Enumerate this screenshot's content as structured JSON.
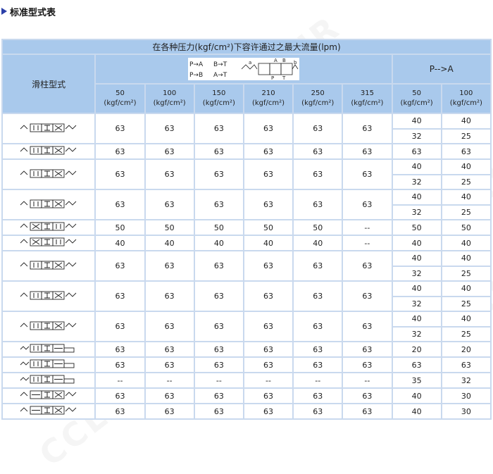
{
  "heading": {
    "text": "标准型式表"
  },
  "table": {
    "top_header": "在各种压力(kgf/cm²)下容许通过之最大流量(lpm)",
    "spool_header": "滑柱型式",
    "pa_header": "P-->A",
    "legend": {
      "line1a": "P→A",
      "line1b": "B→T",
      "line2a": "P→B",
      "line2b": "A→T",
      "port_a": "A",
      "port_b": "B",
      "port_p": "P",
      "port_t": "T",
      "port_sa": "a",
      "port_sb": "b"
    },
    "pressures": [
      "50",
      "100",
      "150",
      "210",
      "250",
      "315"
    ],
    "pa_pressures": [
      "50",
      "100"
    ],
    "unit": "(kgf/cm²)",
    "rows": [
      {
        "vals": [
          "63",
          "63",
          "63",
          "63",
          "63",
          "63"
        ],
        "pa": [
          [
            "40",
            "40"
          ],
          [
            "32",
            "25"
          ]
        ]
      },
      {
        "vals": [
          "63",
          "63",
          "63",
          "63",
          "63",
          "63"
        ],
        "pa": [
          [
            "63",
            "63"
          ]
        ]
      },
      {
        "vals": [
          "63",
          "63",
          "63",
          "63",
          "63",
          "63"
        ],
        "pa": [
          [
            "40",
            "40"
          ],
          [
            "32",
            "25"
          ]
        ]
      },
      {
        "vals": [
          "63",
          "63",
          "63",
          "63",
          "63",
          "63"
        ],
        "pa": [
          [
            "40",
            "40"
          ],
          [
            "32",
            "25"
          ]
        ]
      },
      {
        "vals": [
          "50",
          "50",
          "50",
          "50",
          "50",
          "--"
        ],
        "pa": [
          [
            "50",
            "50"
          ]
        ]
      },
      {
        "vals": [
          "40",
          "40",
          "40",
          "40",
          "40",
          "--"
        ],
        "pa": [
          [
            "40",
            "40"
          ]
        ]
      },
      {
        "vals": [
          "63",
          "63",
          "63",
          "63",
          "63",
          "63"
        ],
        "pa": [
          [
            "40",
            "40"
          ],
          [
            "32",
            "25"
          ]
        ]
      },
      {
        "vals": [
          "63",
          "63",
          "63",
          "63",
          "63",
          "63"
        ],
        "pa": [
          [
            "40",
            "40"
          ],
          [
            "32",
            "25"
          ]
        ]
      },
      {
        "vals": [
          "63",
          "63",
          "63",
          "63",
          "63",
          "63"
        ],
        "pa": [
          [
            "40",
            "40"
          ],
          [
            "32",
            "25"
          ]
        ]
      },
      {
        "vals": [
          "63",
          "63",
          "63",
          "63",
          "63",
          "63"
        ],
        "pa": [
          [
            "20",
            "20"
          ]
        ]
      },
      {
        "vals": [
          "63",
          "63",
          "63",
          "63",
          "63",
          "63"
        ],
        "pa": [
          [
            "63",
            "63"
          ]
        ]
      },
      {
        "vals": [
          "--",
          "--",
          "--",
          "--",
          "--",
          "--"
        ],
        "pa": [
          [
            "35",
            "32"
          ]
        ]
      },
      {
        "vals": [
          "63",
          "63",
          "63",
          "63",
          "63",
          "63"
        ],
        "pa": [
          [
            "40",
            "30"
          ]
        ]
      },
      {
        "vals": [
          "63",
          "63",
          "63",
          "63",
          "63",
          "63"
        ],
        "pa": [
          [
            "40",
            "30"
          ]
        ]
      }
    ]
  },
  "watermark": "CCLAIR",
  "colors": {
    "header_bg": "#a9c9ec",
    "border": "#c9d9ee",
    "icon": "#2b3fa8"
  }
}
